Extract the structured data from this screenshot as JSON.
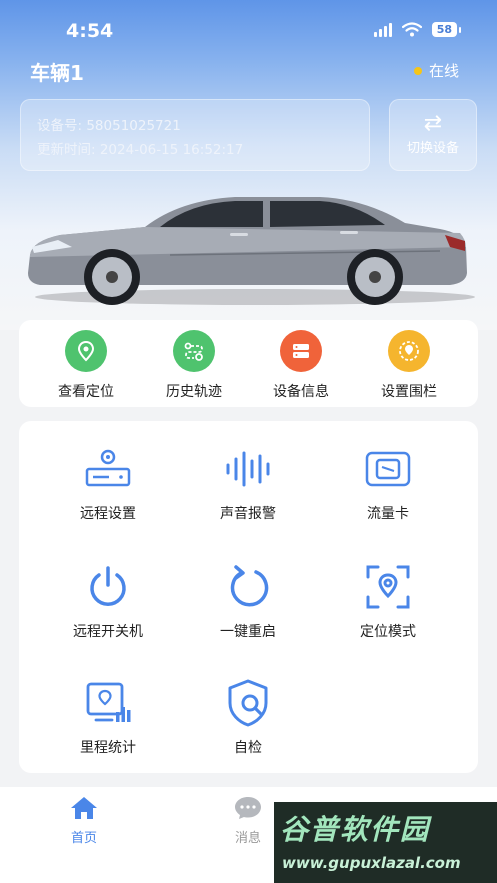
{
  "status_bar": {
    "time": "4:54",
    "battery": "58"
  },
  "header": {
    "title": "车辆1",
    "status": "在线",
    "status_color": "#f5c518"
  },
  "device": {
    "id_text": "设备号: 58051025721",
    "update_text": "更新时间: 2024-06-15 16:52:17",
    "switch_label": "切换设备"
  },
  "quick_actions": [
    {
      "label": "查看定位",
      "icon": "location-pin-icon",
      "color": "#4fc36e"
    },
    {
      "label": "历史轨迹",
      "icon": "route-history-icon",
      "color": "#4fc36e"
    },
    {
      "label": "设备信息",
      "icon": "device-info-icon",
      "color": "#f0633a"
    },
    {
      "label": "设置围栏",
      "icon": "geofence-icon",
      "color": "#f5b52e"
    }
  ],
  "grid": [
    {
      "label": "远程设置",
      "icon": "remote-settings-icon"
    },
    {
      "label": "声音报警",
      "icon": "sound-wave-icon"
    },
    {
      "label": "流量卡",
      "icon": "sim-card-icon"
    },
    {
      "label": "远程开关机",
      "icon": "power-icon"
    },
    {
      "label": "一键重启",
      "icon": "restart-icon"
    },
    {
      "label": "定位模式",
      "icon": "location-mode-icon"
    },
    {
      "label": "里程统计",
      "icon": "mileage-stats-icon"
    },
    {
      "label": "自检",
      "icon": "self-check-icon"
    }
  ],
  "accent_color": "#4a86e8",
  "tabs": [
    {
      "label": "首页",
      "icon": "home-icon",
      "active": true
    },
    {
      "label": "消息",
      "icon": "message-icon",
      "active": false
    }
  ],
  "watermark": {
    "title": "谷普软件园",
    "url": "www.gupuxlazal.com"
  }
}
